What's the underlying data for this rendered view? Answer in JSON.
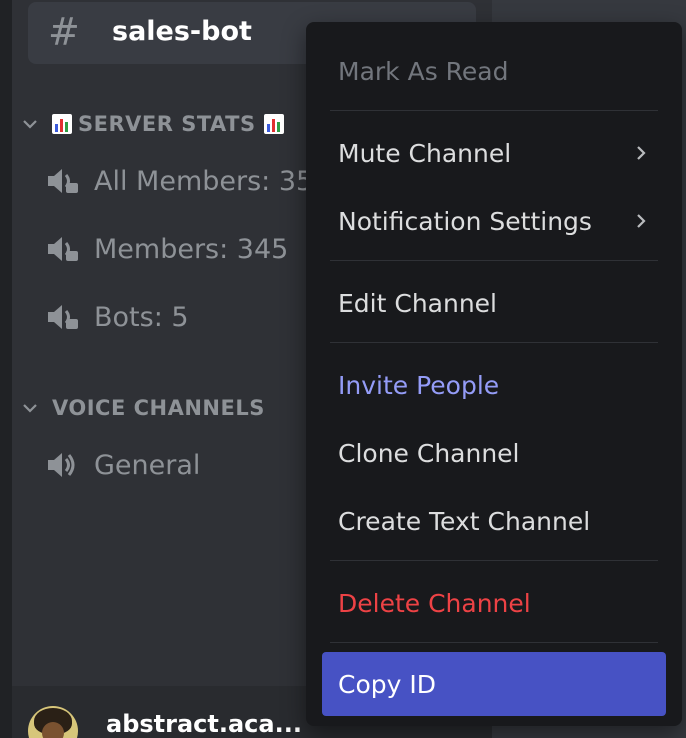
{
  "sidebar": {
    "active_channel": {
      "name": "sales-bot",
      "icon": "hash-icon"
    },
    "categories": [
      {
        "label": "SERVER STATS",
        "channels": [
          "All Members: 35",
          "Members: 345",
          "Bots: 5"
        ]
      },
      {
        "label": "VOICE CHANNELS",
        "channels": [
          "General"
        ]
      }
    ]
  },
  "user": {
    "name": "abstract.aca..."
  },
  "context_menu": {
    "items": [
      {
        "label": "Mark As Read",
        "state": "disabled"
      },
      {
        "label": "Mute Channel",
        "submenu": true
      },
      {
        "label": "Notification Settings",
        "submenu": true
      },
      {
        "label": "Edit Channel"
      },
      {
        "label": "Invite People",
        "color": "#949cf7"
      },
      {
        "label": "Clone Channel"
      },
      {
        "label": "Create Text Channel"
      },
      {
        "label": "Delete Channel",
        "color": "#ed4245"
      },
      {
        "label": "Copy ID",
        "state": "highlighted"
      }
    ]
  },
  "colors": {
    "sidebar_bg": "#2f3136",
    "menu_bg": "#18191c",
    "highlight": "#4752c4",
    "muted_text": "#8e9297"
  }
}
